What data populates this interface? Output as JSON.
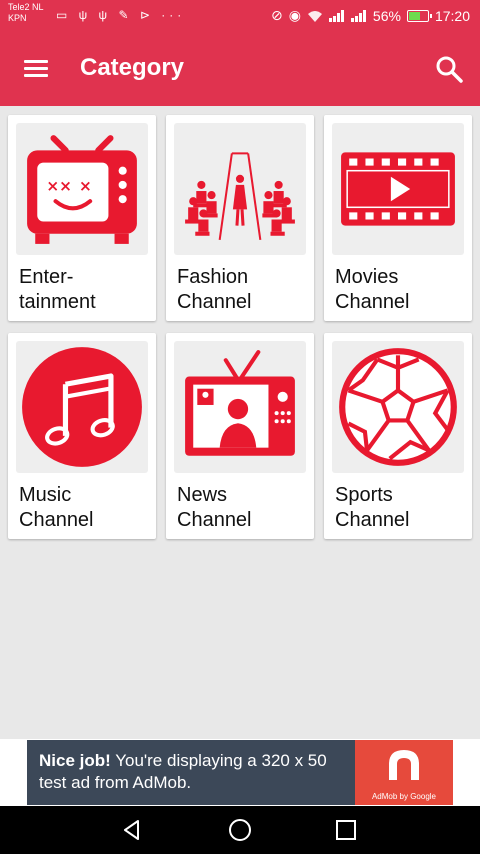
{
  "status_bar": {
    "carrier_line1": "Tele2 NL",
    "carrier_line2": "KPN",
    "left_icons": "▭ ψ ψ ✎ ⊳ ···",
    "battery_percent": "56%",
    "time": "17:20"
  },
  "app_bar": {
    "title": "Category"
  },
  "categories": [
    {
      "label": "Enter-\ntainment",
      "icon": "tv-face-icon"
    },
    {
      "label": "Fashion\nChannel",
      "icon": "runway-icon"
    },
    {
      "label": "Movies\nChannel",
      "icon": "film-play-icon"
    },
    {
      "label": "Music\nChannel",
      "icon": "music-note-icon"
    },
    {
      "label": "News\nChannel",
      "icon": "news-tv-icon"
    },
    {
      "label": "Sports\nChannel",
      "icon": "soccer-ball-icon"
    }
  ],
  "ad": {
    "headline": "Nice job!",
    "body": " You're displaying a 320 x 50 test ad from AdMob.",
    "brand": "AdMob by Google"
  },
  "colors": {
    "primary": "#e0334f",
    "icon_red": "#e8192f",
    "ad_bg": "#3c4858",
    "ad_logo_bg": "#e64a3c"
  }
}
